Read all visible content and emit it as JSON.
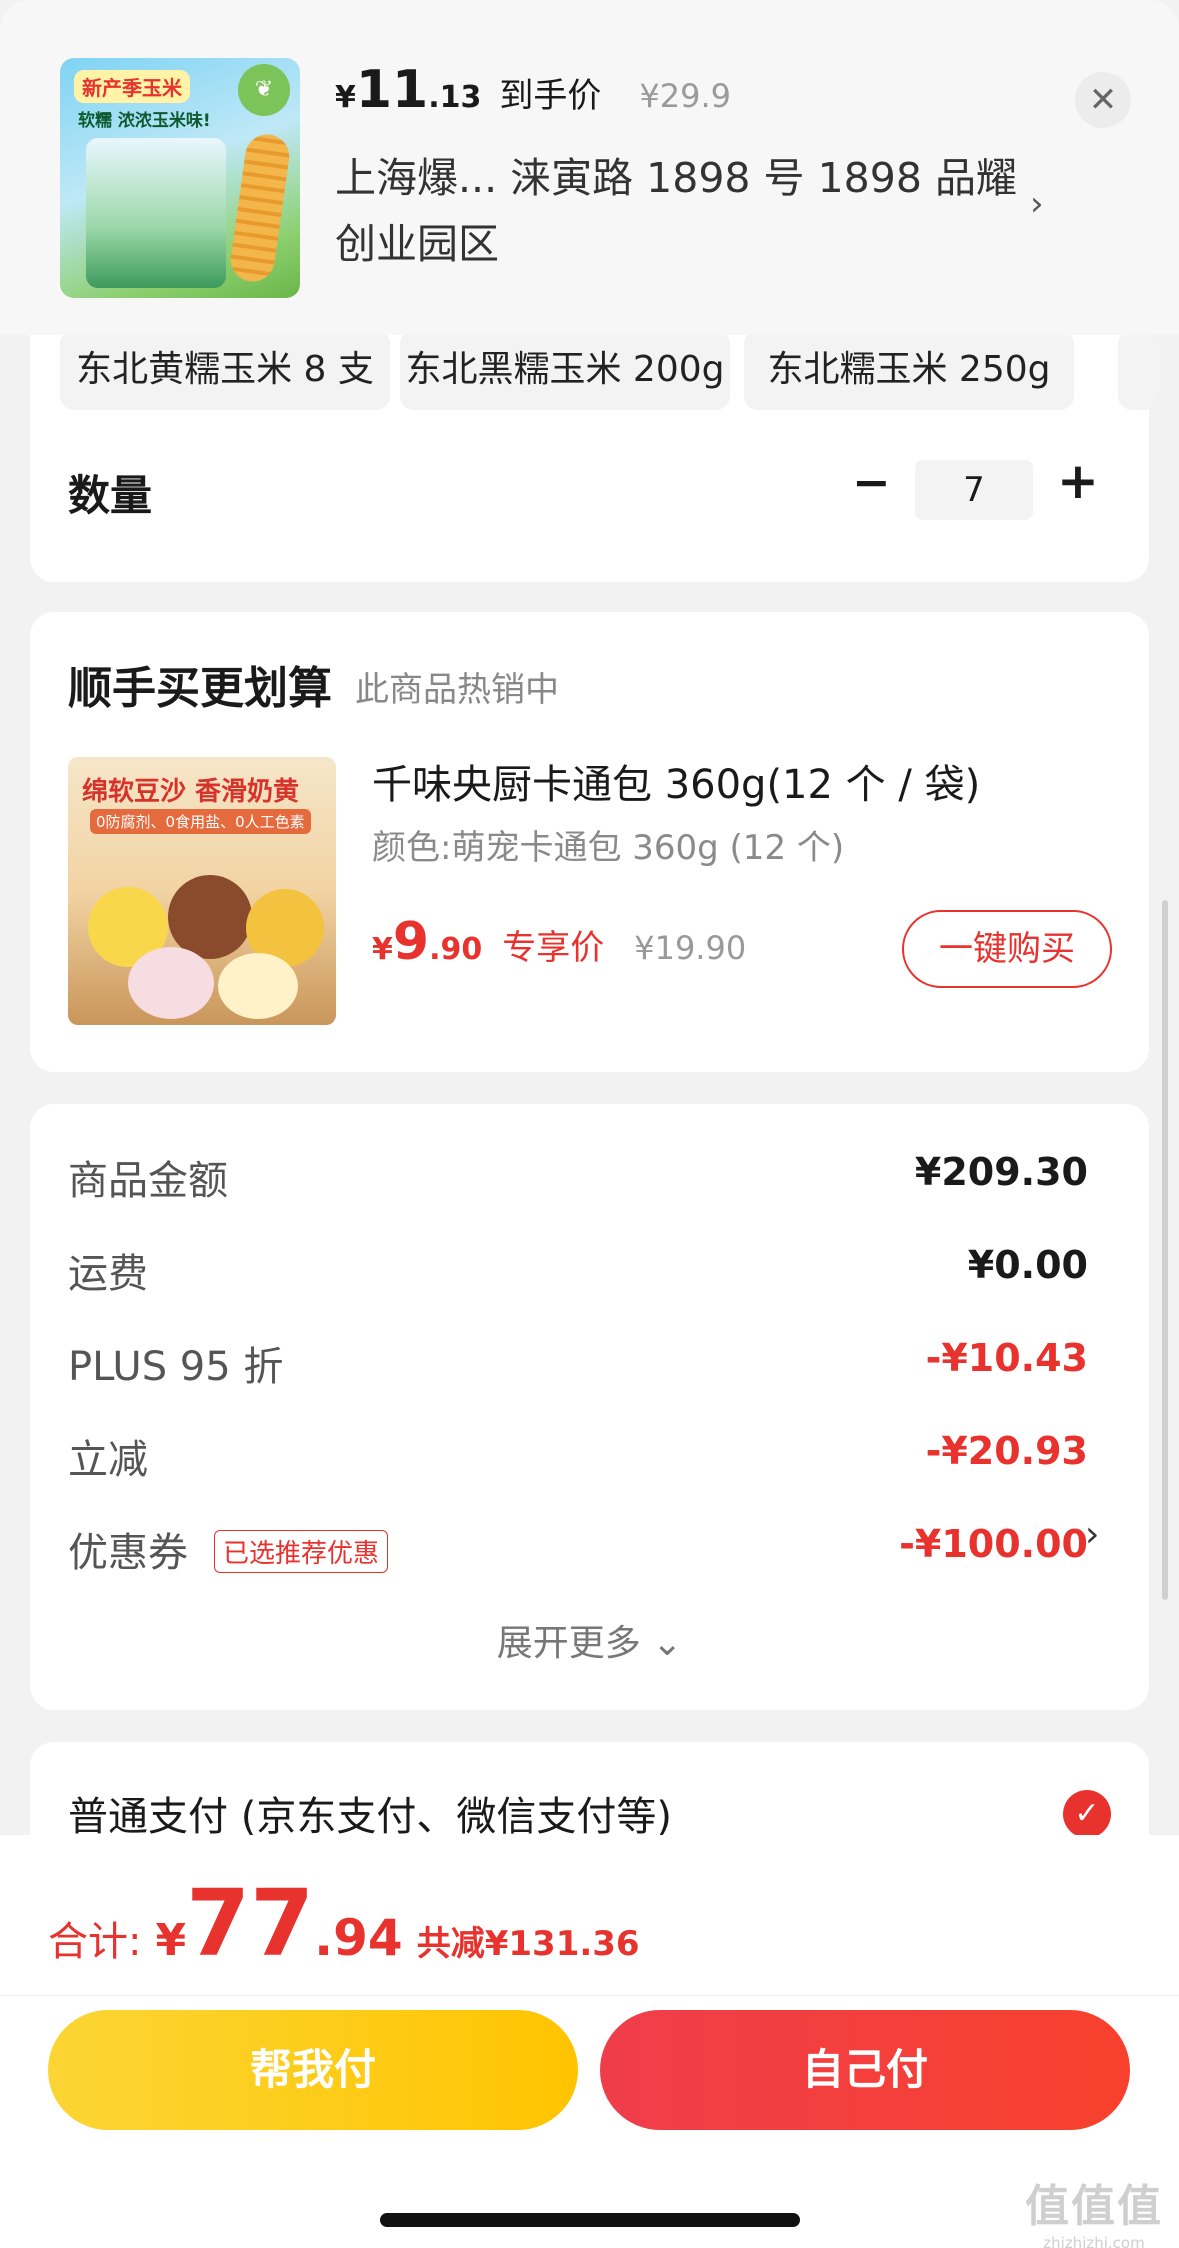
{
  "header": {
    "thumb_badge": "新产季玉米",
    "thumb_slogan": "软糯 浓浓玉米味!",
    "currency": "¥",
    "price_int": "11",
    "price_dec": ".13",
    "final_label": "到手价",
    "original_price": "¥29.9",
    "address": "上海爆...  涞寅路 1898 号 1898 品耀创业园区",
    "close_icon": "close-icon"
  },
  "specs": {
    "chips": [
      "东北黄糯玉米 8 支",
      "东北黑糯玉米 200g",
      "东北糯玉米 250g"
    ],
    "qty_label": "数量",
    "qty_value": "7",
    "minus": "−",
    "plus": "+"
  },
  "upsell": {
    "title": "顺手买更划算",
    "subtitle": "此商品热销中",
    "img_headline": "绵软豆沙 香滑奶黄",
    "img_sub": "0防腐剂、0食用盐、0人工色素",
    "name": "千味央厨卡通包 360g(12 个 / 袋)",
    "color": "颜色:萌宠卡通包 360g (12 个)",
    "currency": "¥",
    "price_int": "9",
    "price_dec": ".90",
    "exclusive": "专享价",
    "original": "¥19.90",
    "buy_label": "一键购买"
  },
  "detail": {
    "rows": [
      {
        "label": "商品金额",
        "value": "¥209.30"
      },
      {
        "label": "运费",
        "value": "¥0.00"
      },
      {
        "label": "PLUS 95 折",
        "value": "-¥10.43"
      },
      {
        "label": "立减",
        "value": "-¥20.93"
      },
      {
        "label": "优惠券",
        "value": "-¥100.00"
      }
    ],
    "coupon_tag": "已选推荐优惠",
    "expand": "展开更多 ⌄"
  },
  "payment": {
    "label": "普通支付 (京东支付、微信支付等)"
  },
  "bottom": {
    "total_label": "合计:",
    "currency": "¥",
    "total_int": "77",
    "total_dec": ".94",
    "saved": "共减¥131.36",
    "help_pay": "帮我付",
    "self_pay": "自己付"
  },
  "watermark": {
    "main": "值值值",
    "site": "zhizhizhi.com"
  },
  "colors": {
    "accent_red": "#e8322e",
    "yellow_button": "#ffc400",
    "red_button": "#f03d4b"
  }
}
